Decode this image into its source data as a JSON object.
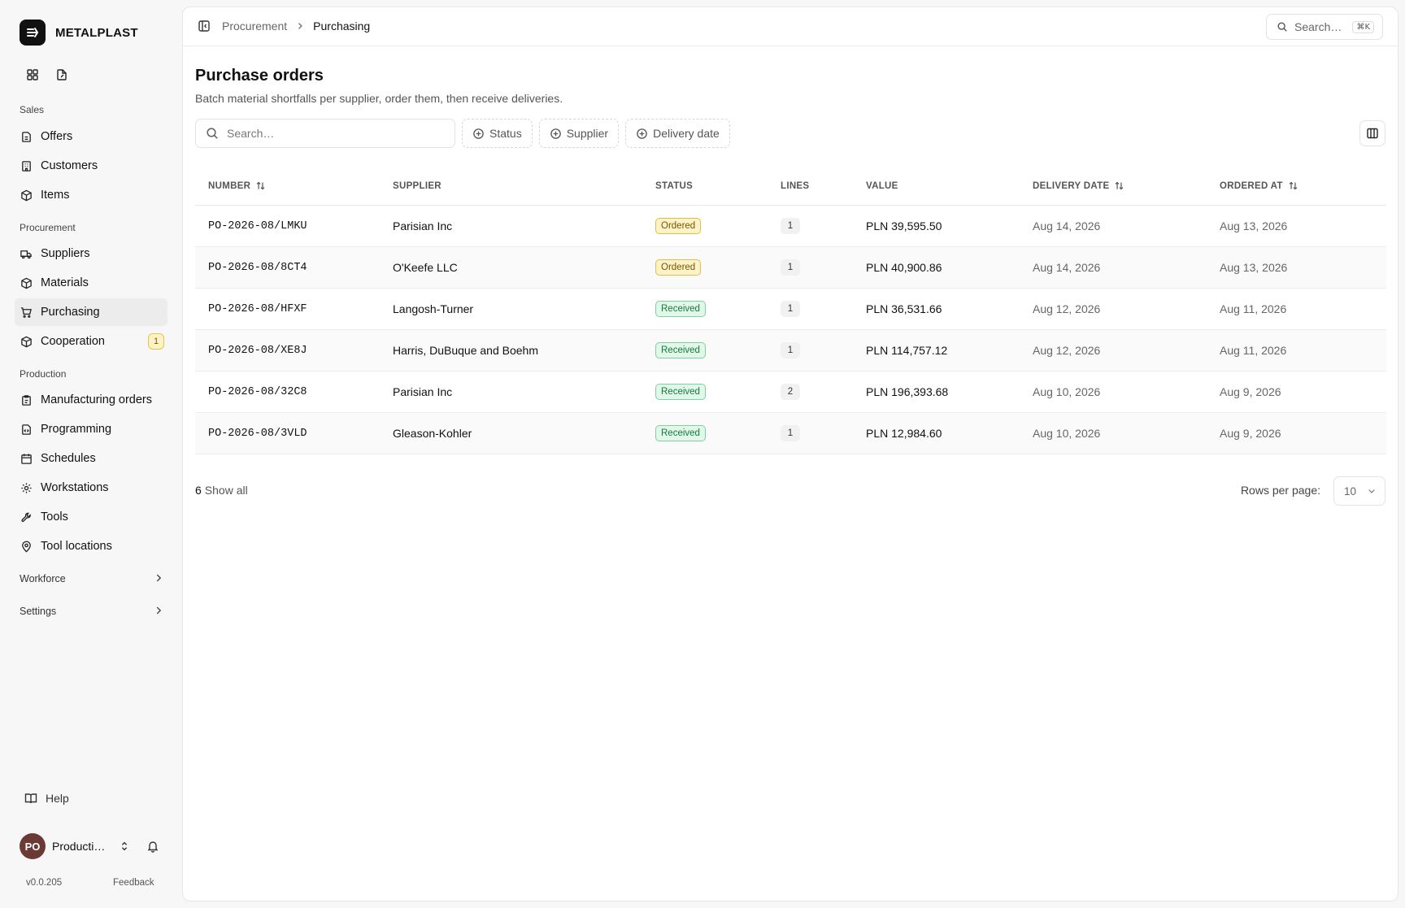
{
  "brand": {
    "name": "METALPLAST"
  },
  "sidebar": {
    "sections": {
      "sales": "Sales",
      "procurement": "Procurement",
      "production": "Production"
    },
    "items": {
      "offers": "Offers",
      "customers": "Customers",
      "items": "Items",
      "suppliers": "Suppliers",
      "materials": "Materials",
      "purchasing": "Purchasing",
      "cooperation": "Cooperation",
      "cooperation_badge": "1",
      "manufacturing_orders": "Manufacturing orders",
      "programming": "Programming",
      "schedules": "Schedules",
      "workstations": "Workstations",
      "tools": "Tools",
      "tool_locations": "Tool locations"
    },
    "groups": {
      "workforce": "Workforce",
      "settings": "Settings"
    },
    "help": "Help",
    "user": {
      "initials": "PO",
      "name": "Producti…"
    },
    "version": "v0.0.205",
    "feedback": "Feedback"
  },
  "topbar": {
    "breadcrumb": [
      "Procurement",
      "Purchasing"
    ],
    "search_placeholder": "Search…",
    "search_shortcut": "⌘K"
  },
  "page": {
    "title": "Purchase orders",
    "subtitle": "Batch material shortfalls per supplier, order them, then receive deliveries."
  },
  "toolbar": {
    "search_placeholder": "Search…",
    "filters": [
      "Status",
      "Supplier",
      "Delivery date"
    ]
  },
  "table": {
    "columns": {
      "number": "NUMBER",
      "supplier": "SUPPLIER",
      "status": "STATUS",
      "lines": "LINES",
      "value": "VALUE",
      "delivery_date": "DELIVERY DATE",
      "ordered_at": "ORDERED AT"
    },
    "rows": [
      {
        "number": "PO-2026-08/LMKU",
        "supplier": "Parisian Inc",
        "status": "Ordered",
        "lines": "1",
        "value": "PLN 39,595.50",
        "delivery_date": "Aug 14, 2026",
        "ordered_at": "Aug 13, 2026"
      },
      {
        "number": "PO-2026-08/8CT4",
        "supplier": "O'Keefe LLC",
        "status": "Ordered",
        "lines": "1",
        "value": "PLN 40,900.86",
        "delivery_date": "Aug 14, 2026",
        "ordered_at": "Aug 13, 2026"
      },
      {
        "number": "PO-2026-08/HFXF",
        "supplier": "Langosh-Turner",
        "status": "Received",
        "lines": "1",
        "value": "PLN 36,531.66",
        "delivery_date": "Aug 12, 2026",
        "ordered_at": "Aug 11, 2026"
      },
      {
        "number": "PO-2026-08/XE8J",
        "supplier": "Harris, DuBuque and Boehm",
        "status": "Received",
        "lines": "1",
        "value": "PLN 114,757.12",
        "delivery_date": "Aug 12, 2026",
        "ordered_at": "Aug 11, 2026"
      },
      {
        "number": "PO-2026-08/32C8",
        "supplier": "Parisian Inc",
        "status": "Received",
        "lines": "2",
        "value": "PLN 196,393.68",
        "delivery_date": "Aug 10, 2026",
        "ordered_at": "Aug 9, 2026"
      },
      {
        "number": "PO-2026-08/3VLD",
        "supplier": "Gleason-Kohler",
        "status": "Received",
        "lines": "1",
        "value": "PLN 12,984.60",
        "delivery_date": "Aug 10, 2026",
        "ordered_at": "Aug 9, 2026"
      }
    ]
  },
  "footer": {
    "count": "6",
    "show_all": "Show all",
    "rows_per_page_label": "Rows per page:",
    "rows_per_page_value": "10"
  },
  "colors": {
    "ordered_bg": "#fdf3c8",
    "received_bg": "#e2f7ea",
    "brand": "#111111",
    "avatar": "#6b3a34"
  }
}
